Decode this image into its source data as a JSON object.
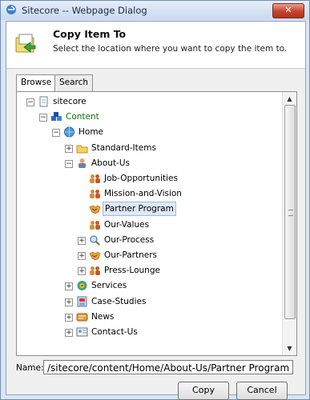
{
  "window": {
    "title": "Sitecore -- Webpage Dialog",
    "close_label": "✕"
  },
  "header": {
    "title": "Copy Item To",
    "subtitle": "Select the location where you want to copy the item to."
  },
  "tabs": [
    {
      "label": "Browse",
      "active": true
    },
    {
      "label": "Search",
      "active": false
    }
  ],
  "tree": {
    "items": [
      {
        "label": "sitecore",
        "icon": "document-icon",
        "expander": "−",
        "level": 0
      },
      {
        "label": "Content",
        "icon": "content-cubes-icon",
        "expander": "−",
        "level": 1,
        "color": "#0b6d0b"
      },
      {
        "label": "Home",
        "icon": "home-globe-icon",
        "expander": "−",
        "level": 2
      },
      {
        "label": "Standard-Items",
        "icon": "folder-icon",
        "expander": "+",
        "level": 3
      },
      {
        "label": "About-Us",
        "icon": "person-icon",
        "expander": "−",
        "level": 3
      },
      {
        "label": "Job-Opportunities",
        "icon": "people-icon",
        "expander": "",
        "level": 4
      },
      {
        "label": "Mission-and-Vision",
        "icon": "people-icon",
        "expander": "",
        "level": 4
      },
      {
        "label": "Partner Program",
        "icon": "handshake-icon",
        "expander": "",
        "level": 4,
        "selected": true
      },
      {
        "label": "Our-Values",
        "icon": "people-icon",
        "expander": "",
        "level": 4
      },
      {
        "label": "Our-Process",
        "icon": "magnifier-icon",
        "expander": "+",
        "level": 4
      },
      {
        "label": "Our-Partners",
        "icon": "handshake-icon",
        "expander": "+",
        "level": 4
      },
      {
        "label": "Press-Lounge",
        "icon": "people-icon",
        "expander": "+",
        "level": 4
      },
      {
        "label": "Services",
        "icon": "services-icon",
        "expander": "+",
        "level": 3
      },
      {
        "label": "Case-Studies",
        "icon": "case-studies-icon",
        "expander": "+",
        "level": 3
      },
      {
        "label": "News",
        "icon": "news-icon",
        "expander": "+",
        "level": 3
      },
      {
        "label": "Contact-Us",
        "icon": "contact-card-icon",
        "expander": "+",
        "level": 3
      }
    ]
  },
  "name_field": {
    "label": "Name:",
    "value": "/sitecore/content/Home/About-Us/Partner Program"
  },
  "buttons": {
    "copy": "Copy",
    "cancel": "Cancel"
  },
  "colors": {
    "selected_bg": "#dfe8f6",
    "content_text": "#0b6d0b",
    "close_button": "#c7422c"
  }
}
